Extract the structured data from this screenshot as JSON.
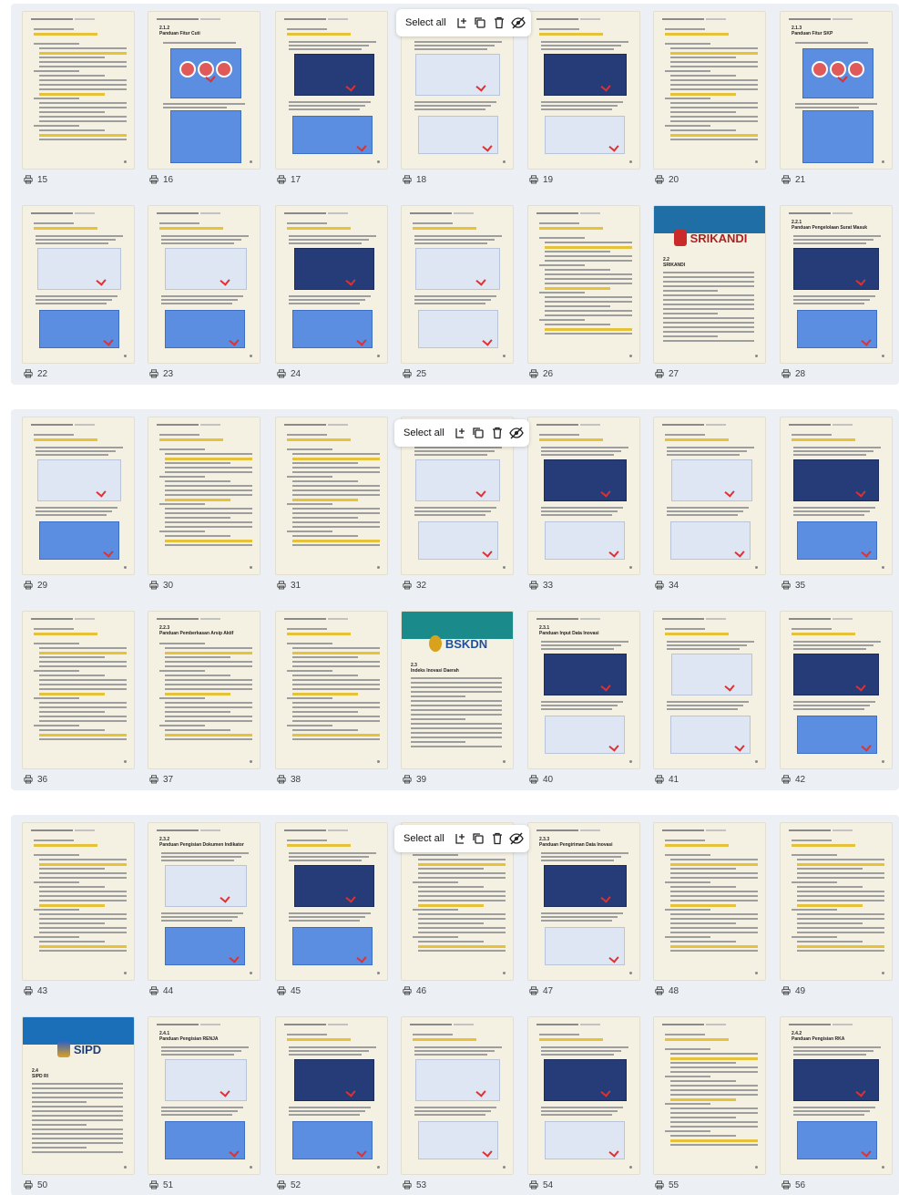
{
  "toolbar": {
    "select_all_label": "Select all",
    "icons": [
      "add-page-icon",
      "duplicate-icon",
      "trash-icon",
      "hide-icon"
    ]
  },
  "groups": [
    {
      "pages": [
        {
          "num": "15",
          "kind": "text"
        },
        {
          "num": "16",
          "kind": "circles",
          "title": "2.1.2\nPanduan Fitur Cuti"
        },
        {
          "num": "17",
          "kind": "screens"
        },
        {
          "num": "18",
          "kind": "screens"
        },
        {
          "num": "19",
          "kind": "screens"
        },
        {
          "num": "20",
          "kind": "text"
        },
        {
          "num": "21",
          "kind": "circles",
          "title": "2.1.3\nPanduan Fitur SKP"
        },
        {
          "num": "22",
          "kind": "screens"
        },
        {
          "num": "23",
          "kind": "screens"
        },
        {
          "num": "24",
          "kind": "screens"
        },
        {
          "num": "25",
          "kind": "screens"
        },
        {
          "num": "26",
          "kind": "text"
        },
        {
          "num": "27",
          "kind": "cover",
          "brand": "SRIKANDI",
          "section": "2.2\nSRIKANDI"
        },
        {
          "num": "28",
          "kind": "screens",
          "title": "2.2.1\nPanduan Pengelolaan Surat Masuk"
        }
      ]
    },
    {
      "pages": [
        {
          "num": "29",
          "kind": "screens"
        },
        {
          "num": "30",
          "kind": "text"
        },
        {
          "num": "31",
          "kind": "text"
        },
        {
          "num": "32",
          "kind": "screens"
        },
        {
          "num": "33",
          "kind": "screens"
        },
        {
          "num": "34",
          "kind": "screens"
        },
        {
          "num": "35",
          "kind": "screens"
        },
        {
          "num": "36",
          "kind": "text"
        },
        {
          "num": "37",
          "kind": "text",
          "title": "2.2.3\nPanduan Pemberkasan Arsip Aktif"
        },
        {
          "num": "38",
          "kind": "text"
        },
        {
          "num": "39",
          "kind": "cover",
          "brand": "BSKDN",
          "section": "2.3\nIndeks Inovasi Daerah"
        },
        {
          "num": "40",
          "kind": "screens",
          "title": "2.3.1\nPanduan Input Data Inovasi"
        },
        {
          "num": "41",
          "kind": "screens"
        },
        {
          "num": "42",
          "kind": "screens"
        }
      ]
    },
    {
      "pages": [
        {
          "num": "43",
          "kind": "text"
        },
        {
          "num": "44",
          "kind": "screens",
          "title": "2.3.2\nPanduan Pengisian Dokumen Indikator"
        },
        {
          "num": "45",
          "kind": "screens"
        },
        {
          "num": "46",
          "kind": "text"
        },
        {
          "num": "47",
          "kind": "screens",
          "title": "2.3.3\nPanduan Pengiriman Data Inovasi"
        },
        {
          "num": "48",
          "kind": "text"
        },
        {
          "num": "49",
          "kind": "text"
        },
        {
          "num": "50",
          "kind": "cover",
          "brand": "SIPD",
          "section": "2.4\nSIPD RI"
        },
        {
          "num": "51",
          "kind": "screens",
          "title": "2.4.1\nPanduan Pengisian RENJA"
        },
        {
          "num": "52",
          "kind": "screens"
        },
        {
          "num": "53",
          "kind": "screens"
        },
        {
          "num": "54",
          "kind": "screens"
        },
        {
          "num": "55",
          "kind": "text"
        },
        {
          "num": "56",
          "kind": "screens",
          "title": "2.4.2\nPanduan Pengisian RKA"
        }
      ]
    }
  ]
}
